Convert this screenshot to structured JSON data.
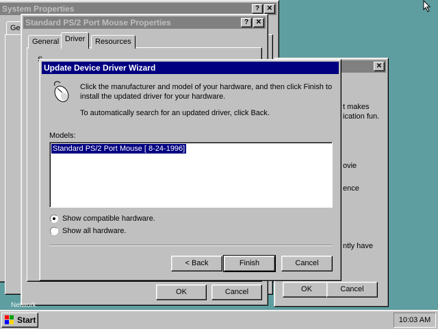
{
  "system_properties": {
    "title": "System Properties",
    "help_btn": "?",
    "close_btn": "✕",
    "tab_partial": "Ge",
    "bottom_partial": "Network"
  },
  "background_dialog": {
    "close_btn": "✕",
    "text_lines": [
      "t makes",
      "ication fun.",
      "ovie",
      "ence",
      "ntly have"
    ],
    "ok_label": "OK",
    "cancel_label": "Cancel"
  },
  "mouse_properties": {
    "title": "Standard PS/2 Port Mouse Properties",
    "help_btn": "?",
    "close_btn": "✕",
    "tabs": [
      "General",
      "Driver",
      "Resources"
    ],
    "partial_char": "S",
    "ok_label": "OK",
    "cancel_label": "Cancel"
  },
  "wizard": {
    "title": "Update Device Driver Wizard",
    "instruction": "Click the manufacturer and model of your hardware, and then click Finish to install the updated driver for your hardware.",
    "auto_search": "To automatically search for an updated driver, click Back.",
    "models_label": "Models:",
    "models": [
      "Standard PS/2 Port Mouse [ 8-24-1996]"
    ],
    "radio_compatible": "Show compatible hardware.",
    "radio_all": "Show all hardware.",
    "back_label": "< Back",
    "finish_label": "Finish",
    "cancel_label": "Cancel"
  },
  "taskbar": {
    "start_label": "Start",
    "clock": "10:03 AM"
  },
  "colors": {
    "desktop": "#5f9ea0",
    "active_title": "#000080",
    "inactive_title": "#808080",
    "selection": "#000080"
  }
}
